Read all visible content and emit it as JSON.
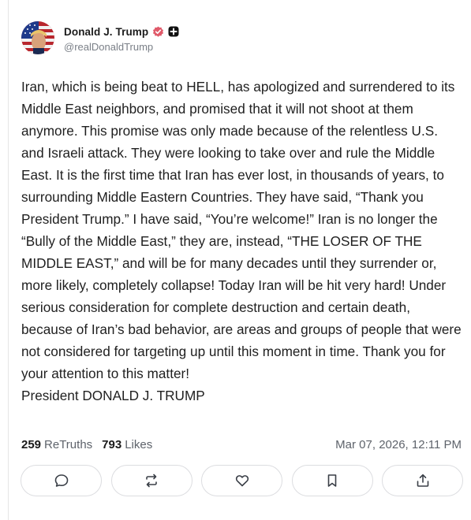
{
  "post": {
    "author": {
      "display_name": "Donald J. Trump",
      "handle": "@realDonaldTrump",
      "verified_icon": "verified-badge-icon",
      "badge_icon": "plus-badge-icon"
    },
    "text": "Iran, which is being beat to HELL, has apologized and surrendered to its Middle East neighbors, and promised that it will not shoot at them anymore. This promise was only made because of the relentless U.S. and Israeli attack. They were looking to take over and rule the Middle East. It is the first time that Iran has ever lost, in thousands of years, to surrounding Middle Eastern Countries. They have said, “Thank you President Trump.” I have said, “You’re welcome!” Iran is no longer the “Bully of the Middle East,” they are, instead, “THE LOSER OF THE MIDDLE EAST,” and will be for many decades until they surrender or, more likely, completely collapse! Today Iran will be hit very hard! Under serious consideration for complete destruction and certain death, because of Iran’s bad behavior, are areas and groups of people that were not considered for targeting up until this moment in time. Thank you for your attention to this matter!\nPresident DONALD J. TRUMP",
    "stats": {
      "retruths_count": "259",
      "retruths_label": "ReTruths",
      "likes_count": "793",
      "likes_label": "Likes"
    },
    "timestamp": "Mar 07, 2026, 12:11 PM"
  },
  "actions": [
    {
      "name": "reply",
      "icon": "comment-icon"
    },
    {
      "name": "retruth",
      "icon": "repost-icon"
    },
    {
      "name": "like",
      "icon": "heart-icon"
    },
    {
      "name": "bookmark",
      "icon": "bookmark-icon"
    },
    {
      "name": "share",
      "icon": "share-icon"
    }
  ],
  "colors": {
    "verified": "#e05a6a",
    "text": "#1f1f1f",
    "muted": "#5e636b",
    "border": "#dcdde0"
  }
}
